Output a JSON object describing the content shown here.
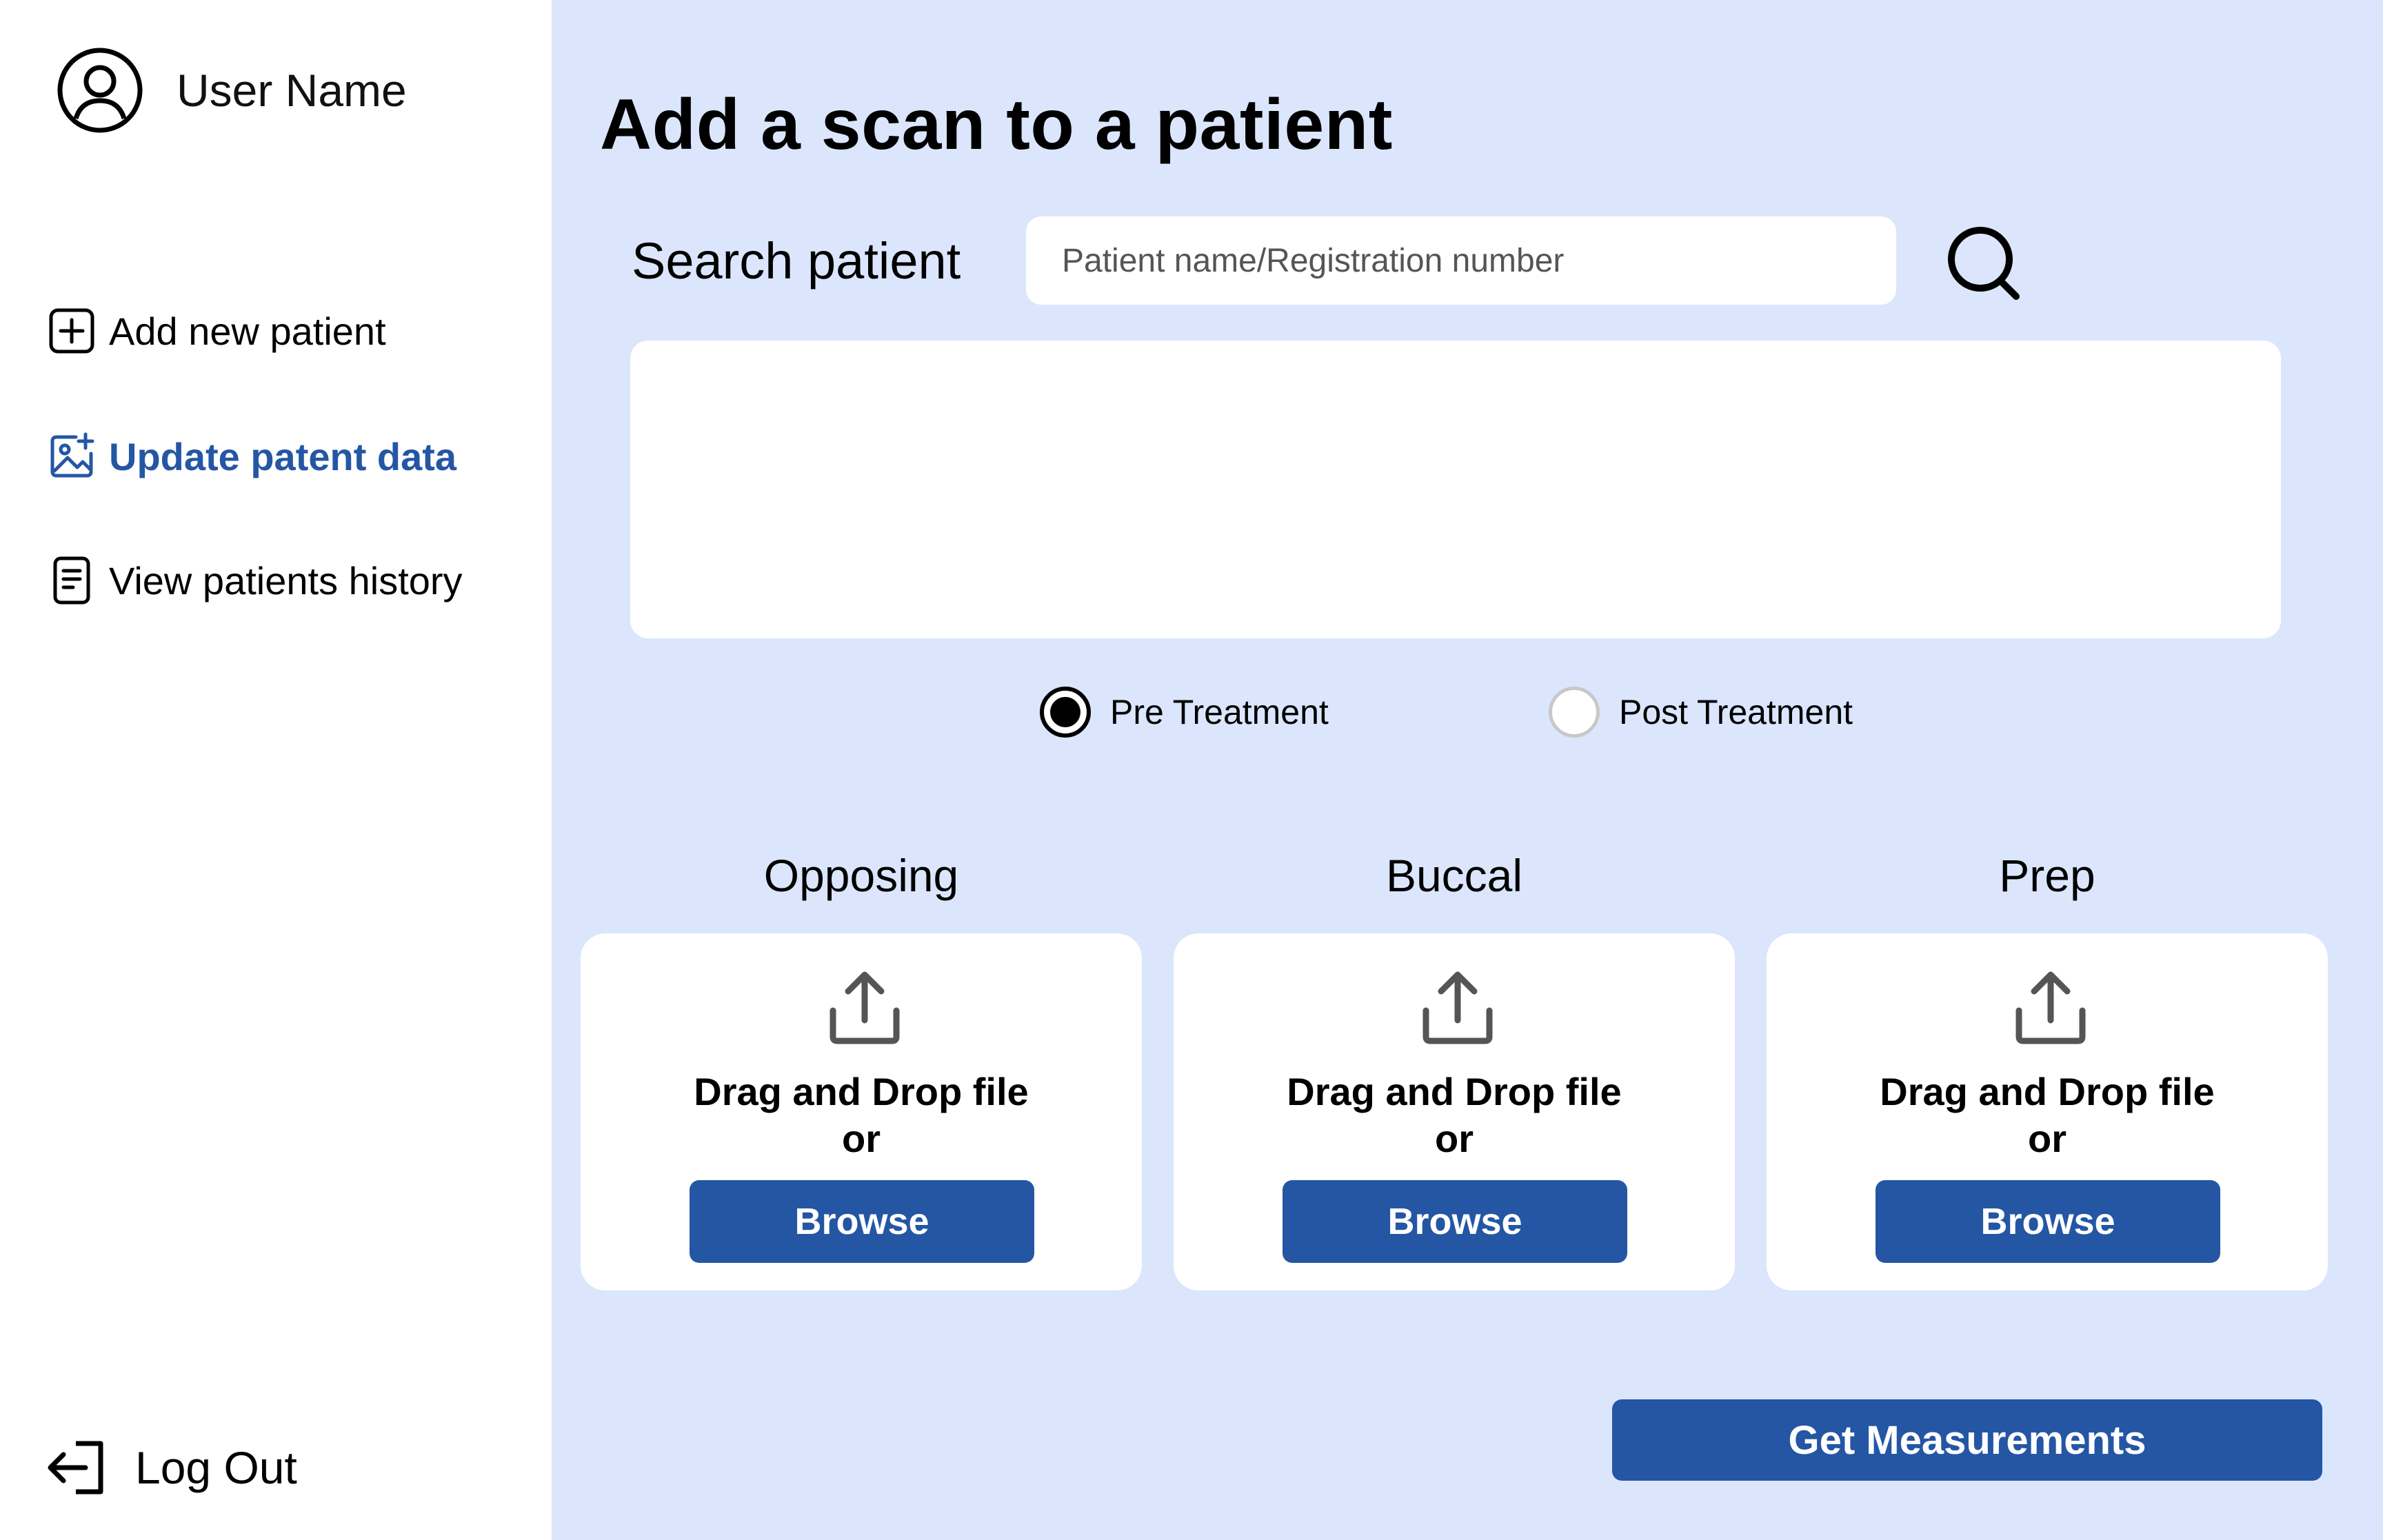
{
  "user": {
    "name": "User Name"
  },
  "sidebar": {
    "items": [
      {
        "label": "Add new patient",
        "icon": "plus-square-icon"
      },
      {
        "label": "Update patent data",
        "icon": "image-plus-icon",
        "active": true
      },
      {
        "label": "View patients history",
        "icon": "document-icon"
      }
    ],
    "logout_label": "Log Out"
  },
  "main": {
    "title": "Add a scan to a patient",
    "search": {
      "label": "Search patient",
      "placeholder": "Patient name/Registration number",
      "value": ""
    },
    "treatment": {
      "options": [
        "Pre Treatment",
        "Post Treatment"
      ],
      "selected": "Pre Treatment"
    },
    "uploads": [
      {
        "label": "Opposing",
        "drag_text": "Drag and Drop file",
        "or_text": "or",
        "browse_label": "Browse"
      },
      {
        "label": "Buccal",
        "drag_text": "Drag and Drop file",
        "or_text": "or",
        "browse_label": "Browse"
      },
      {
        "label": "Prep",
        "drag_text": "Drag and Drop file",
        "or_text": "or",
        "browse_label": "Browse"
      }
    ],
    "submit_label": "Get Measurements"
  },
  "colors": {
    "accent": "#2456a4",
    "main_background": "#dbe6fd",
    "sidebar_background": "#ffffff"
  }
}
